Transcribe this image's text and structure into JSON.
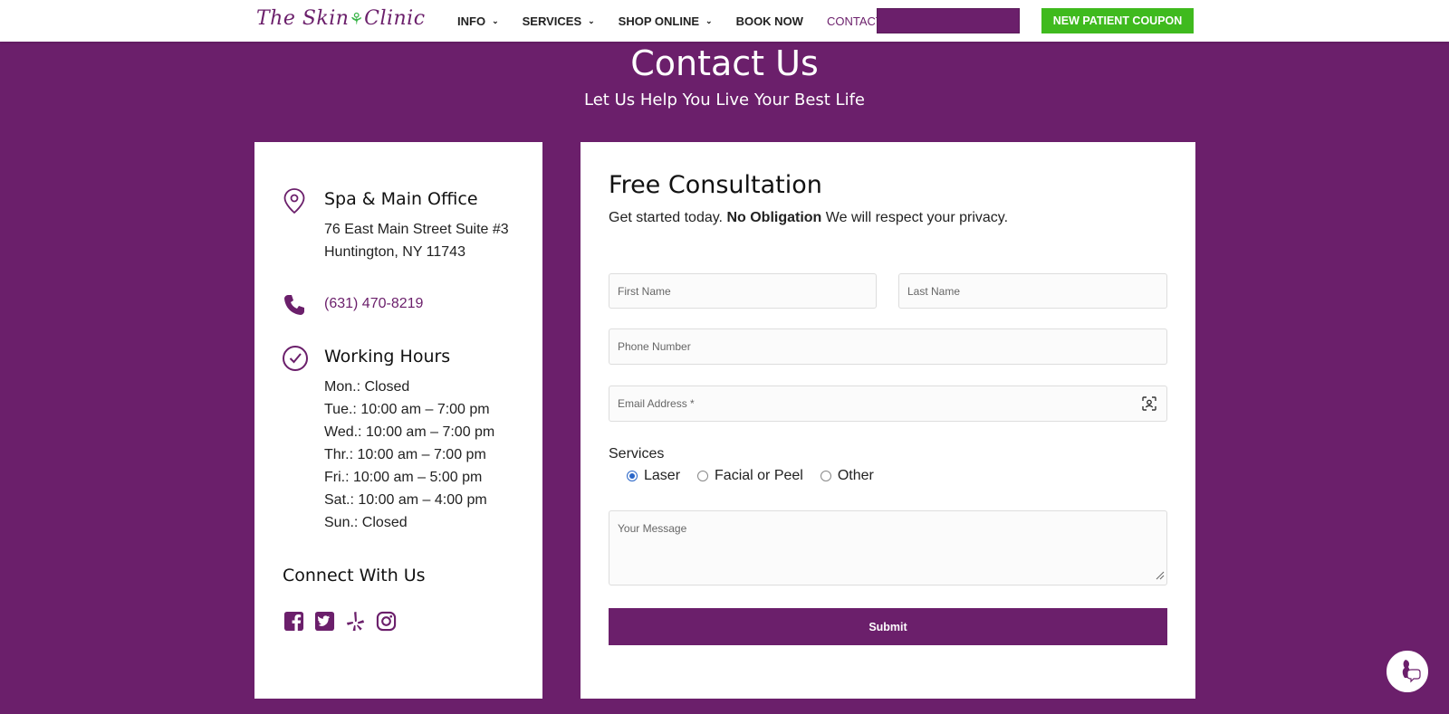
{
  "header": {
    "logo_text": "The Skin",
    "logo_text2": "Clinic",
    "nav": [
      {
        "label": "INFO",
        "has_menu": true
      },
      {
        "label": "SERVICES",
        "has_menu": true
      },
      {
        "label": "SHOP ONLINE",
        "has_menu": true
      },
      {
        "label": "BOOK NOW",
        "has_menu": false
      },
      {
        "label": "CONTACT",
        "has_menu": false
      }
    ],
    "coupon_label": "NEW PATIENT COUPON"
  },
  "hero": {
    "title": "Contact Us",
    "subtitle": "Let Us Help You Live Your Best Life"
  },
  "contact": {
    "office_title": "Spa & Main Office",
    "address_line1": "76 East Main Street Suite #3",
    "address_line2": "Huntington, NY 11743",
    "phone": "(631) 470-8219",
    "hours_title": "Working Hours",
    "hours": [
      "Mon.: Closed",
      "Tue.: 10:00 am – 7:00 pm",
      "Wed.: 10:00 am – 7:00 pm",
      "Thr.: 10:00 am – 7:00 pm",
      "Fri.: 10:00 am – 5:00 pm",
      "Sat.: 10:00 am – 4:00 pm",
      "Sun.: Closed"
    ],
    "connect_title": "Connect With Us",
    "social_icons": [
      "facebook-icon",
      "twitter-icon",
      "yelp-icon",
      "instagram-icon"
    ]
  },
  "form": {
    "title": "Free Consultation",
    "intro_start": "Get started today.",
    "intro_bold": "No Obligation",
    "intro_end": "We will respect your privacy.",
    "first_name_placeholder": "First Name",
    "last_name_placeholder": "Last Name",
    "phone_placeholder": "Phone Number",
    "email_placeholder": "Email Address *",
    "services_label": "Services",
    "services_options": [
      "Laser",
      "Facial or Peel",
      "Other"
    ],
    "services_selected": "Laser",
    "message_placeholder": "Your Message",
    "submit_label": "Submit"
  },
  "colors": {
    "brand_purple": "#6b1f6b",
    "coupon_green": "#3fba1e",
    "radio_blue": "#2a66c8"
  }
}
